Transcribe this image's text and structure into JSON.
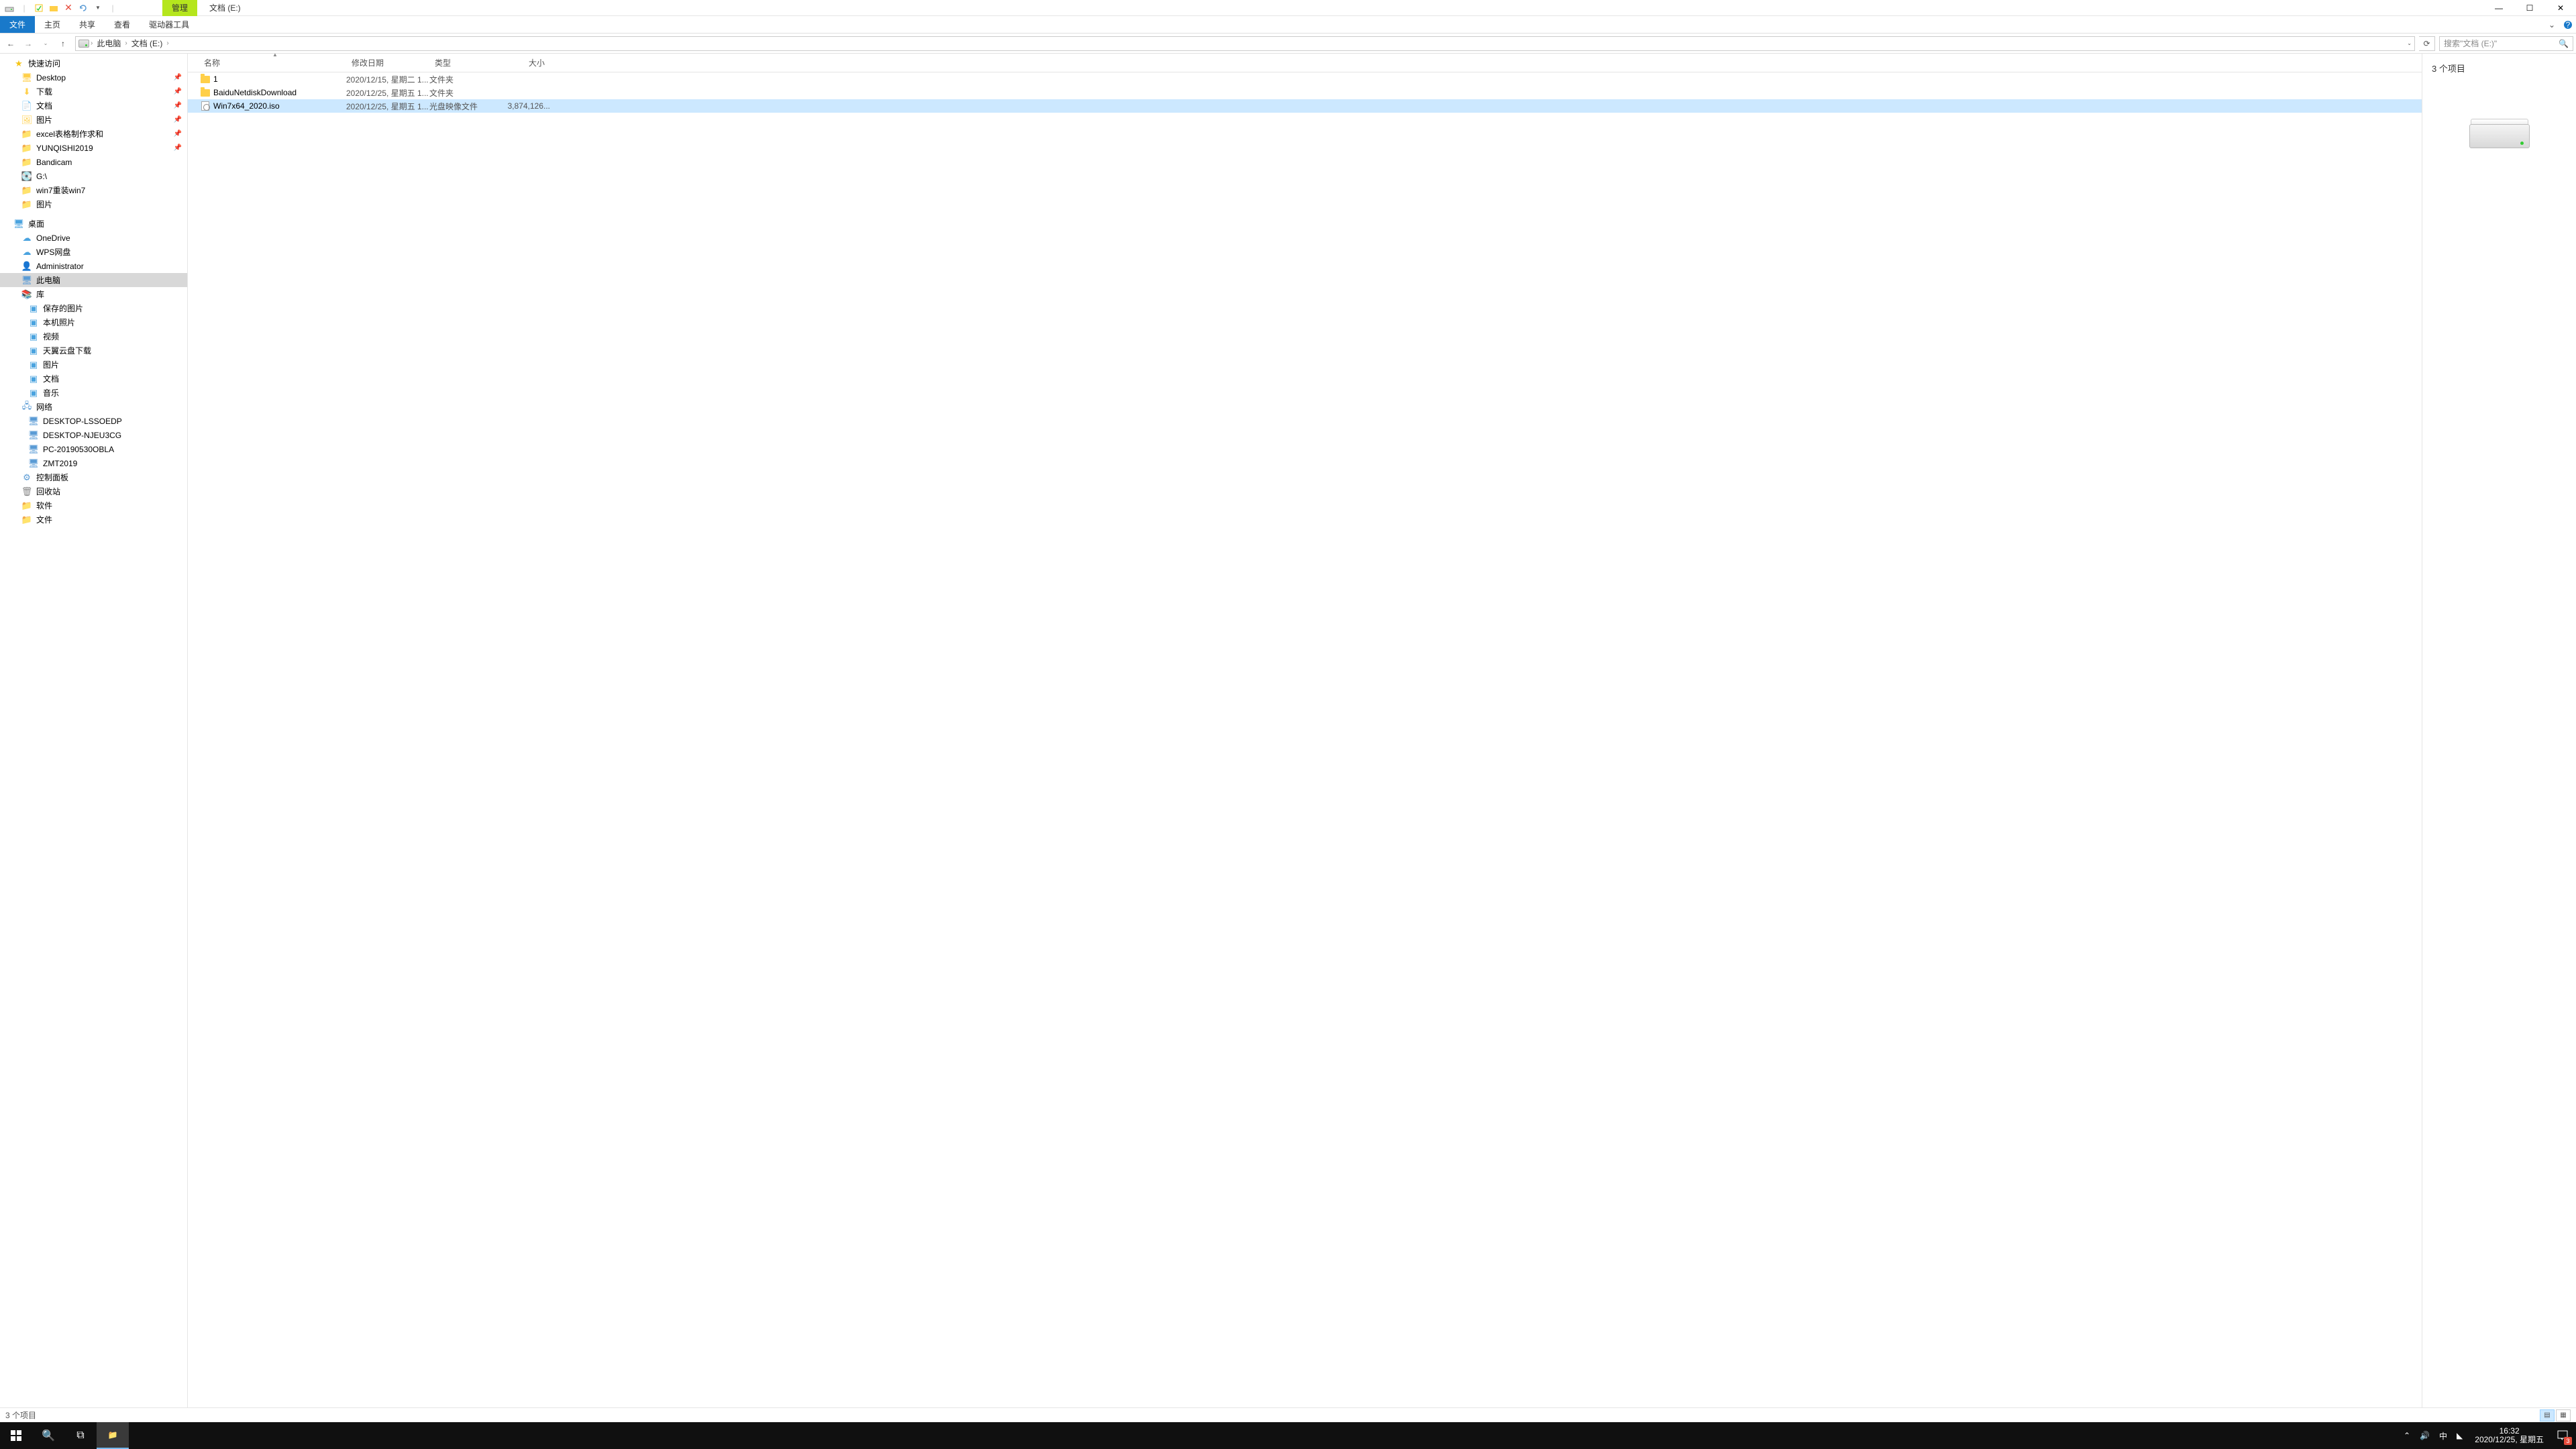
{
  "titlebar": {
    "manage_tab": "管理",
    "title": "文档 (E:)"
  },
  "ribbon": {
    "file": "文件",
    "home": "主页",
    "share": "共享",
    "view": "查看",
    "drive_tools": "驱动器工具"
  },
  "breadcrumb": {
    "pc": "此电脑",
    "drive": "文档 (E:)"
  },
  "nav": {
    "dropdown_hint": "",
    "refresh": "⟳"
  },
  "search": {
    "placeholder": "搜索\"文档 (E:)\""
  },
  "columns": {
    "name": "名称",
    "date": "修改日期",
    "type": "类型",
    "size": "大小"
  },
  "files": [
    {
      "name": "1",
      "date": "2020/12/15, 星期二 1...",
      "type": "文件夹",
      "size": "",
      "icon": "folder",
      "selected": false
    },
    {
      "name": "BaiduNetdiskDownload",
      "date": "2020/12/25, 星期五 1...",
      "type": "文件夹",
      "size": "",
      "icon": "folder",
      "selected": false
    },
    {
      "name": "Win7x64_2020.iso",
      "date": "2020/12/25, 星期五 1...",
      "type": "光盘映像文件",
      "size": "3,874,126...",
      "icon": "iso",
      "selected": true
    }
  ],
  "sidebar": {
    "quick_access": "快速访问",
    "quick_items": [
      {
        "label": "Desktop",
        "icon": "desktop",
        "pinned": true
      },
      {
        "label": "下载",
        "icon": "download",
        "pinned": true
      },
      {
        "label": "文档",
        "icon": "doc",
        "pinned": true
      },
      {
        "label": "图片",
        "icon": "pic",
        "pinned": true
      },
      {
        "label": "excel表格制作求和",
        "icon": "folder",
        "pinned": true
      },
      {
        "label": "YUNQISHI2019",
        "icon": "folder",
        "pinned": true
      },
      {
        "label": "Bandicam",
        "icon": "folder",
        "pinned": false
      },
      {
        "label": "G:\\",
        "icon": "drive",
        "pinned": false
      },
      {
        "label": "win7重装win7",
        "icon": "folder",
        "pinned": false
      },
      {
        "label": "图片",
        "icon": "folder",
        "pinned": false
      }
    ],
    "desktop": "桌面",
    "onedrive": "OneDrive",
    "wps": "WPS网盘",
    "admin": "Administrator",
    "this_pc": "此电脑",
    "libraries": "库",
    "lib_items": [
      "保存的图片",
      "本机照片",
      "视频",
      "天翼云盘下载",
      "图片",
      "文档",
      "音乐"
    ],
    "network": "网络",
    "net_items": [
      "DESKTOP-LSSOEDP",
      "DESKTOP-NJEU3CG",
      "PC-20190530OBLA",
      "ZMT2019"
    ],
    "control_panel": "控制面板",
    "recycle": "回收站",
    "software": "软件",
    "files_folder": "文件"
  },
  "preview": {
    "count": "3 个项目"
  },
  "status": {
    "count": "3 个项目"
  },
  "taskbar": {
    "time": "16:32",
    "date": "2020/12/25, 星期五",
    "ime": "中",
    "notif_count": "3"
  }
}
